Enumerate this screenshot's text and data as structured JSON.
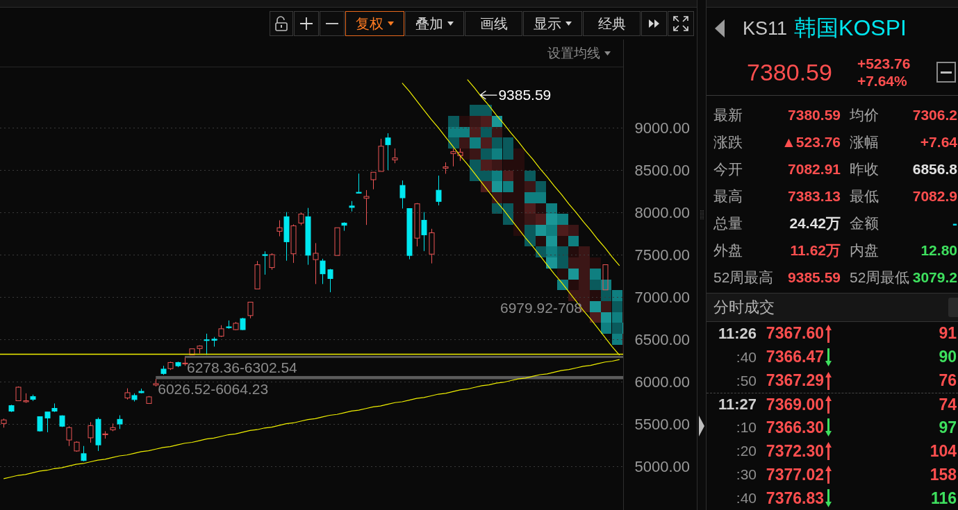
{
  "toolbar": {
    "buttons": [
      {
        "label": "复权",
        "dropdown": true,
        "selected": true
      },
      {
        "label": "叠加",
        "dropdown": true,
        "selected": false
      },
      {
        "label": "画线",
        "dropdown": false,
        "selected": false
      },
      {
        "label": "显示",
        "dropdown": true,
        "selected": false
      },
      {
        "label": "经典",
        "dropdown": false,
        "selected": false
      }
    ]
  },
  "chart": {
    "ma_setting": {
      "label": "设置均线"
    },
    "chart_data": [
      {
        "type": "candlestick",
        "categories": [
          null,
          null,
          null,
          null,
          null,
          null,
          null,
          null,
          null,
          null,
          null,
          null,
          null,
          null,
          null,
          null,
          null,
          null,
          null,
          null,
          null,
          null,
          null,
          null,
          null,
          null,
          null,
          null,
          null,
          null,
          null,
          null,
          null,
          null,
          null,
          null,
          null,
          null,
          null,
          null,
          null,
          null,
          null,
          null,
          null,
          null,
          null,
          null,
          null,
          null,
          null,
          null,
          null,
          null,
          null,
          null,
          null,
          null,
          null,
          null,
          null,
          null,
          null,
          null,
          null,
          null,
          null,
          null,
          null,
          null,
          null,
          null,
          null,
          null,
          null,
          null,
          null,
          null,
          null,
          null,
          null,
          null,
          null,
          null,
          null,
          null
        ],
        "ohlc": [
          [
            5503,
            5561,
            5454,
            5545
          ],
          [
            5714,
            5724,
            5639,
            5649
          ],
          [
            5772,
            5941,
            5772,
            5932
          ],
          [
            5760,
            5860,
            5747,
            5772
          ],
          [
            5821,
            5844,
            5769,
            5789
          ],
          [
            5584,
            5584,
            5406,
            5415
          ],
          [
            5639,
            5639,
            5399,
            5568
          ],
          [
            5682,
            5740,
            5639,
            5649
          ],
          [
            5594,
            5600,
            5461,
            5471
          ],
          [
            5308,
            5471,
            5237,
            5454
          ],
          [
            5178,
            5292,
            5169,
            5282
          ],
          [
            5146,
            5237,
            5055,
            5065
          ],
          [
            5334,
            5519,
            5276,
            5477
          ],
          [
            5552,
            5574,
            5178,
            5250
          ],
          [
            5370,
            5412,
            5324,
            5380
          ],
          [
            5428,
            5503,
            5412,
            5454
          ],
          [
            5552,
            5600,
            5438,
            5497
          ],
          [
            5805,
            5919,
            5786,
            5867
          ],
          [
            5834,
            5860,
            5763,
            5786
          ],
          [
            5883,
            5915,
            5860,
            5867
          ],
          [
            5740,
            5828,
            5740,
            5818
          ],
          [
            5958,
            6029,
            5941,
            5974
          ],
          [
            6146,
            6185,
            6078,
            6094
          ],
          [
            6152,
            6234,
            6136,
            6224
          ],
          [
            6224,
            6234,
            6169,
            6185
          ],
          [
            6208,
            6282,
            6185,
            6217
          ],
          [
            6315,
            6386,
            6315,
            6386
          ],
          [
            6389,
            6428,
            6331,
            6419
          ],
          [
            6493,
            6565,
            6315,
            6484
          ],
          [
            6500,
            6526,
            6412,
            6487
          ],
          [
            6536,
            6665,
            6526,
            6623
          ],
          [
            6646,
            6721,
            6623,
            6636
          ],
          [
            6613,
            6704,
            6607,
            6688
          ],
          [
            6743,
            6753,
            6607,
            6613
          ],
          [
            6779,
            6938,
            6747,
            6938
          ],
          [
            7094,
            7425,
            7094,
            7380
          ],
          [
            7500,
            7539,
            7263,
            7490
          ],
          [
            7347,
            7516,
            7321,
            7500
          ],
          [
            7776,
            7906,
            7717,
            7818
          ],
          [
            7948,
            8003,
            7428,
            7652
          ],
          [
            7510,
            7857,
            7402,
            7841
          ],
          [
            7873,
            7997,
            7847,
            7980
          ],
          [
            7948,
            8052,
            7380,
            7493
          ],
          [
            7441,
            7636,
            7152,
            7516
          ],
          [
            7425,
            7451,
            7152,
            7273
          ],
          [
            7321,
            7331,
            7055,
            7217
          ],
          [
            7490,
            7818,
            7490,
            7818
          ],
          [
            7873,
            7883,
            7782,
            7847
          ],
          [
            8075,
            8133,
            8010,
            8058
          ],
          [
            8237,
            8458,
            8227,
            8227
          ],
          [
            8166,
            8263,
            7851,
            8188
          ],
          [
            8386,
            8474,
            8273,
            8474
          ],
          [
            8484,
            8870,
            8484,
            8782
          ],
          [
            8880,
            8935,
            8500,
            8799
          ],
          [
            8620,
            8756,
            8581,
            8643
          ],
          [
            8318,
            8377,
            8045,
            8172
          ],
          [
            8045,
            8045,
            7445,
            7490
          ],
          [
            7695,
            8110,
            7597,
            8101
          ],
          [
            7906,
            8003,
            7542,
            7734
          ],
          [
            7506,
            7805,
            7396,
            7758
          ],
          [
            8261,
            8434,
            8082,
            8129
          ],
          [
            8522,
            8591,
            8456,
            8538
          ],
          [
            8695,
            8755,
            8544,
            8717
          ],
          [
            8670,
            8755,
            8607,
            8711
          ],
          null,
          null,
          null,
          null,
          null,
          null,
          null,
          null,
          null,
          null,
          null,
          null,
          null,
          null,
          null,
          null,
          null,
          null,
          null,
          [
            7082.91,
            7383.13,
            7082.91,
            7380.59
          ],
          null,
          null
        ],
        "ylim": [
          4480,
          9715
        ],
        "yticks": [
          {
            "value": 9000,
            "label": "9000.00"
          },
          {
            "value": 8500,
            "label": "8500.00"
          },
          {
            "value": 8000,
            "label": "8000.00"
          },
          {
            "value": 7500,
            "label": "7500.00"
          },
          {
            "value": 7000,
            "label": "7000.00"
          },
          {
            "value": 6500,
            "label": "6500.00"
          },
          {
            "value": 6000,
            "label": "6000.00"
          },
          {
            "value": 5500,
            "label": "5500.00"
          },
          {
            "value": 5000,
            "label": "5000.00"
          }
        ],
        "grid": true,
        "series": [
          {
            "type": "line",
            "color": "#f0f000",
            "values": [
              4850,
              4870,
              4890,
              4900,
              4920,
              4940,
              4950,
              4970,
              4980,
              5000,
              5020,
              5030,
              5050,
              5070,
              5080,
              5100,
              5120,
              5130,
              5150,
              5170,
              5180,
              5200,
              5220,
              5230,
              5250,
              5270,
              5280,
              5300,
              5320,
              5330,
              5350,
              5370,
              5380,
              5400,
              5420,
              5430,
              5450,
              5460,
              5480,
              5500,
              5510,
              5530,
              5550,
              5560,
              5580,
              5600,
              5610,
              5630,
              5650,
              5660,
              5680,
              5700,
              5710,
              5730,
              5750,
              5760,
              5780,
              5800,
              5810,
              5830,
              5850,
              5860,
              5880,
              5900,
              5910,
              5930,
              5950,
              5960,
              5980,
              5990,
              6010,
              6030,
              6040,
              6060,
              6080,
              6090,
              6110,
              6130,
              6140,
              6160,
              6180,
              6190,
              6210,
              6230,
              6240,
              6260
            ]
          },
          {
            "type": "line",
            "color": "#f0f000",
            "values": [
              null,
              null,
              null,
              null,
              null,
              null,
              null,
              null,
              null,
              null,
              null,
              null,
              null,
              null,
              null,
              null,
              null,
              null,
              null,
              null,
              null,
              null,
              null,
              null,
              null,
              null,
              null,
              null,
              null,
              null,
              null,
              null,
              null,
              null,
              null,
              null,
              null,
              null,
              null,
              null,
              null,
              null,
              null,
              null,
              null,
              null,
              null,
              null,
              null,
              null,
              null,
              null,
              null,
              null,
              null,
              9530,
              9430,
              9320,
              9210,
              9100,
              9000,
              8890,
              8780,
              8670,
              8570,
              8460,
              8350,
              8240,
              8130,
              8030,
              7920,
              7810,
              7700,
              7600,
              7490,
              7380,
              7270,
              7170,
              7060,
              6950,
              6840,
              6740,
              6630,
              6520,
              6410,
              6310
            ]
          },
          {
            "type": "line",
            "color": "#f0f000",
            "values": [
              null,
              null,
              null,
              null,
              null,
              null,
              null,
              null,
              null,
              null,
              null,
              null,
              null,
              null,
              null,
              null,
              null,
              null,
              null,
              null,
              null,
              null,
              null,
              null,
              null,
              null,
              null,
              null,
              null,
              null,
              null,
              null,
              null,
              null,
              null,
              null,
              null,
              null,
              null,
              null,
              null,
              null,
              null,
              null,
              null,
              null,
              null,
              null,
              null,
              null,
              null,
              null,
              null,
              null,
              null,
              null,
              null,
              null,
              null,
              null,
              null,
              null,
              null,
              null,
              9570,
              9470,
              9360,
              9260,
              9150,
              9050,
              8940,
              8840,
              8730,
              8630,
              8520,
              8420,
              8310,
              8210,
              8100,
              8000,
              7890,
              7790,
              7680,
              7580,
              7470,
              7370
            ]
          }
        ],
        "ref_lines": [
          {
            "axis": "y",
            "value": 6322,
            "color": "#f0f000"
          }
        ],
        "bands": [
          {
            "axis": "y",
            "from": 6278.36,
            "to": 6302.54,
            "label": "6278.36-6302.54",
            "color": "#5c5c5c"
          },
          {
            "axis": "y",
            "from": 6026.52,
            "to": 6064.23,
            "label": "6026.52-6064.23",
            "color": "#5c5c5c"
          }
        ],
        "annotations": [
          "9385.59",
          "6979.92-708"
        ]
      }
    ]
  },
  "quote_panel": {
    "code": "KS11",
    "name": "韩国KOSPI",
    "price": "7380.59",
    "change": "+523.76",
    "change_pct": "+7.64%",
    "fields": [
      {
        "label": "最新",
        "value": "7380.59",
        "color": "#ff4f4f"
      },
      {
        "label": "均价",
        "value": "7306.2",
        "color": "#ff4f4f"
      },
      {
        "label": "涨跌",
        "value": "▲523.76",
        "color": "#ff4f4f"
      },
      {
        "label": "涨幅",
        "value": "+7.64",
        "color": "#ff4f4f"
      },
      {
        "label": "今开",
        "value": "7082.91",
        "color": "#ff4f4f"
      },
      {
        "label": "昨收",
        "value": "6856.8",
        "color": "#e2e2e2"
      },
      {
        "label": "最高",
        "value": "7383.13",
        "color": "#ff4f4f"
      },
      {
        "label": "最低",
        "value": "7082.9",
        "color": "#ff4f4f"
      },
      {
        "label": "总量",
        "value": "24.42万",
        "color": "#e2e2e2"
      },
      {
        "label": "金额",
        "value": "-",
        "color": "#00d8e8"
      },
      {
        "label": "外盘",
        "value": "11.62万",
        "color": "#ff4f4f"
      },
      {
        "label": "内盘",
        "value": "12.80",
        "color": "#3ee05e"
      },
      {
        "label": "52周最高",
        "value": "9385.59",
        "color": "#ff4f4f"
      },
      {
        "label": "52周最低",
        "value": "3079.2",
        "color": "#3ee05e"
      }
    ]
  },
  "trades_panel": {
    "title": "分时成交",
    "rows": [
      {
        "time": "11:26",
        "kind": "minute",
        "price": "7367.60",
        "up": true,
        "volume": "91"
      },
      {
        "time": ":40",
        "kind": "second",
        "price": "7366.47",
        "up": false,
        "volume": "90"
      },
      {
        "time": ":50",
        "kind": "second",
        "price": "7367.29",
        "up": true,
        "volume": "76"
      },
      {
        "time": "11:27",
        "kind": "minute",
        "price": "7369.00",
        "up": true,
        "volume": "74"
      },
      {
        "time": ":10",
        "kind": "second",
        "price": "7366.30",
        "up": false,
        "volume": "97"
      },
      {
        "time": ":20",
        "kind": "second",
        "price": "7372.30",
        "up": true,
        "volume": "104"
      },
      {
        "time": ":30",
        "kind": "second",
        "price": "7377.02",
        "up": true,
        "volume": "158"
      },
      {
        "time": ":40",
        "kind": "second",
        "price": "7376.83",
        "up": false,
        "volume": "116"
      }
    ]
  }
}
